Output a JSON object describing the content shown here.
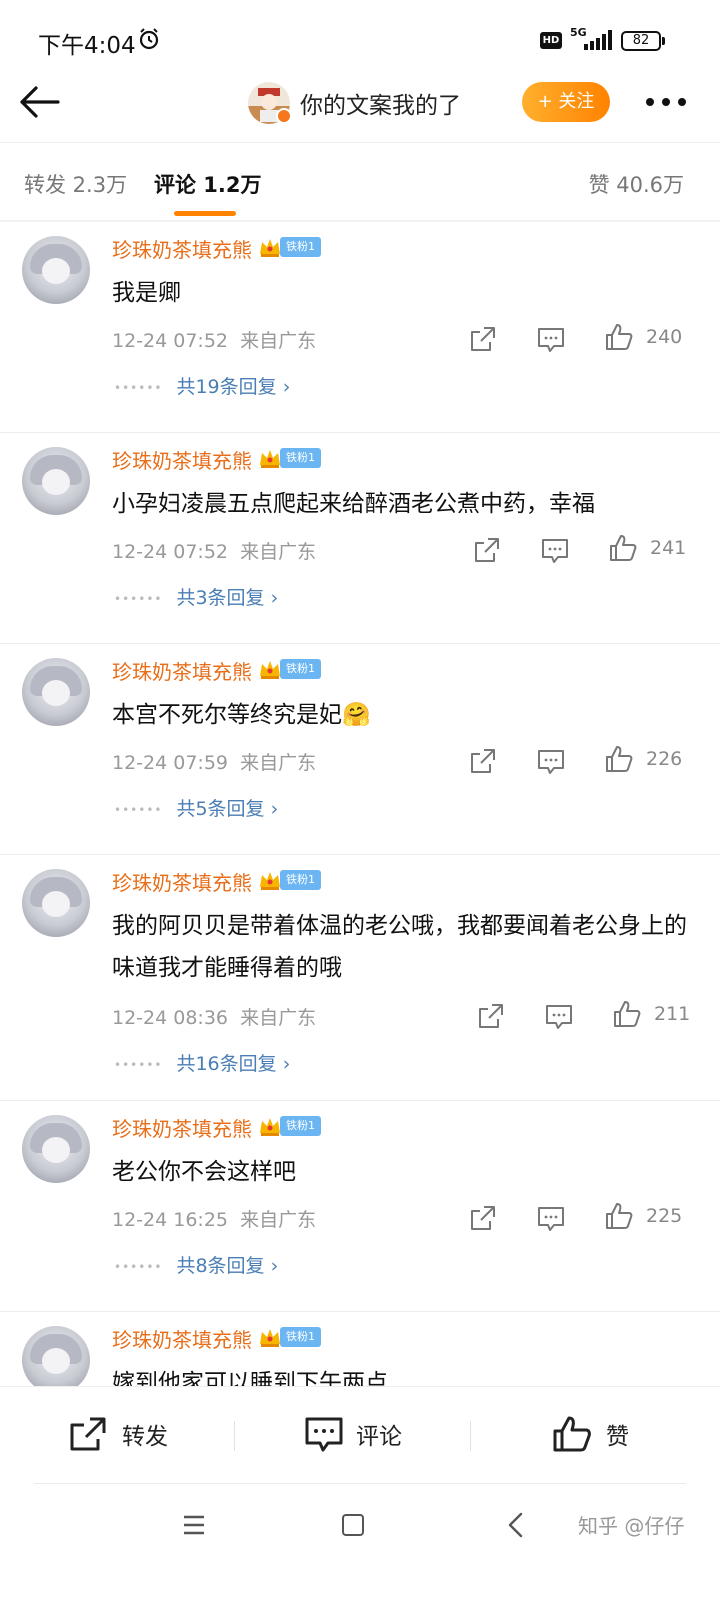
{
  "status_bar": {
    "time": "下午4:04",
    "hd": "HD",
    "network": "5G",
    "battery": "82"
  },
  "header": {
    "title": "你的文案我的了",
    "follow_label": "+ 关注"
  },
  "tabs": {
    "repost": "转发 2.3万",
    "comment": "评论 1.2万",
    "like": "赞 40.6万"
  },
  "colors": {
    "accent": "#ff8200",
    "username": "#e86e19",
    "reply_link": "#4a7eb4",
    "fan_badge": "#6bb6f2"
  },
  "comments": [
    {
      "username": "珍珠奶茶填充熊",
      "badge": "铁粉1",
      "text": "我是卿",
      "time": "12-24 07:52",
      "location": "来自广东",
      "likes": "240",
      "replies": "共19条回复"
    },
    {
      "username": "珍珠奶茶填充熊",
      "badge": "铁粉1",
      "text": "小孕妇凌晨五点爬起来给醉酒老公煮中药，幸福",
      "time": "12-24 07:52",
      "location": "来自广东",
      "likes": "241",
      "replies": "共3条回复"
    },
    {
      "username": "珍珠奶茶填充熊",
      "badge": "铁粉1",
      "text": "本宫不死尔等终究是妃🤗",
      "time": "12-24 07:59",
      "location": "来自广东",
      "likes": "226",
      "replies": "共5条回复"
    },
    {
      "username": "珍珠奶茶填充熊",
      "badge": "铁粉1",
      "text": "我的阿贝贝是带着体温的老公哦，我都要闻着老公身上的味道我才能睡得着的哦",
      "time": "12-24 08:36",
      "location": "来自广东",
      "likes": "211",
      "replies": "共16条回复"
    },
    {
      "username": "珍珠奶茶填充熊",
      "badge": "铁粉1",
      "text": "老公你不会这样吧",
      "time": "12-24 16:25",
      "location": "来自广东",
      "likes": "225",
      "replies": "共8条回复"
    },
    {
      "username": "珍珠奶茶填充熊",
      "badge": "铁粉1",
      "text": "嫁到他家可以睡到下午两点"
    }
  ],
  "action_bar": {
    "repost": "转发",
    "comment": "评论",
    "like": "赞"
  },
  "watermark": "知乎 @仔仔",
  "icons": {
    "back": "back-arrow-icon",
    "more": "more-dots-icon",
    "share": "share-icon",
    "reply": "comment-bubble-icon",
    "like": "thumbs-up-icon",
    "crown": "crown-icon",
    "alarm": "alarm-icon"
  }
}
